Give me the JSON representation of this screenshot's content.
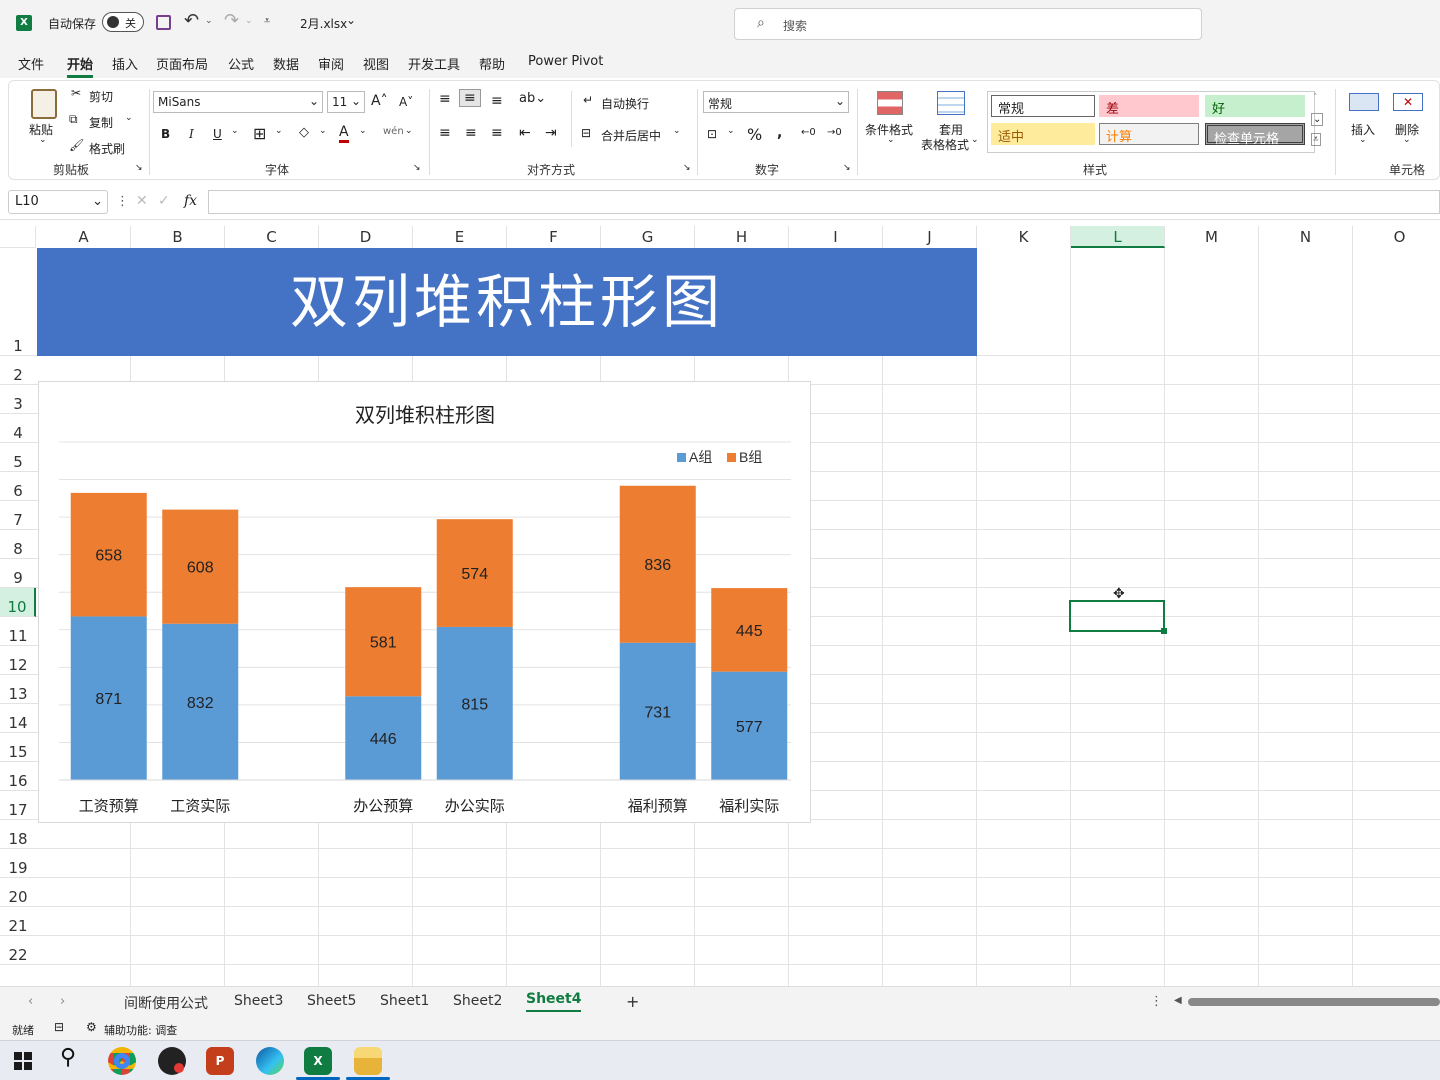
{
  "titlebar": {
    "autosave_label": "自动保存",
    "autosave_state": "关",
    "filename": "2月.xlsx",
    "search_placeholder": "搜索"
  },
  "menu": [
    "文件",
    "开始",
    "插入",
    "页面布局",
    "公式",
    "数据",
    "审阅",
    "视图",
    "开发工具",
    "帮助",
    "Power Pivot"
  ],
  "ribbon": {
    "clipboard": {
      "paste": "粘贴",
      "cut": "剪切",
      "copy": "复制",
      "format_painter": "格式刷",
      "label": "剪贴板"
    },
    "font": {
      "name": "MiSans",
      "size": "11",
      "bold": "B",
      "italic": "I",
      "underline": "U",
      "label": "字体"
    },
    "alignment": {
      "wrap": "自动换行",
      "merge": "合并后居中",
      "label": "对齐方式"
    },
    "number": {
      "format": "常规",
      "percent": "%",
      "label": "数字"
    },
    "styles": {
      "conditional": "条件格式",
      "table_line1": "套用",
      "table_line2": "表格格式",
      "label": "样式",
      "cells": [
        "常规",
        "差",
        "好",
        "适中",
        "计算",
        "检查单元格"
      ]
    },
    "cells": {
      "insert": "插入",
      "delete": "删除",
      "label": "单元格"
    }
  },
  "formula_bar": {
    "name_box": "L10",
    "fx": "fx"
  },
  "columns": [
    "A",
    "B",
    "C",
    "D",
    "E",
    "F",
    "G",
    "H",
    "I",
    "J",
    "K",
    "L",
    "M",
    "N",
    "O"
  ],
  "rows": [
    "1",
    "2",
    "3",
    "4",
    "5",
    "6",
    "7",
    "8",
    "9",
    "10",
    "11",
    "12",
    "13",
    "14",
    "15",
    "16",
    "17",
    "18",
    "19",
    "20",
    "21",
    "22"
  ],
  "banner_title": "双列堆积柱形图",
  "chart_data": {
    "type": "bar",
    "stacked": true,
    "title": "双列堆积柱形图",
    "categories": [
      "工资预算",
      "工资实际",
      "",
      "办公预算",
      "办公实际",
      "",
      "福利预算",
      "福利实际"
    ],
    "series": [
      {
        "name": "A组",
        "color": "#5b9bd5",
        "values": [
          871,
          832,
          null,
          446,
          815,
          null,
          731,
          577
        ]
      },
      {
        "name": "B组",
        "color": "#ed7d31",
        "values": [
          658,
          608,
          null,
          581,
          574,
          null,
          836,
          445
        ]
      }
    ],
    "ylim": [
      0,
      1800
    ],
    "grid": true,
    "legend": "top-right"
  },
  "sheet_tabs": [
    "间断使用公式",
    "Sheet3",
    "Sheet5",
    "Sheet1",
    "Sheet2",
    "Sheet4"
  ],
  "active_tab": "Sheet4",
  "status": {
    "ready": "就绪",
    "accessibility": "辅助功能: 调查"
  }
}
